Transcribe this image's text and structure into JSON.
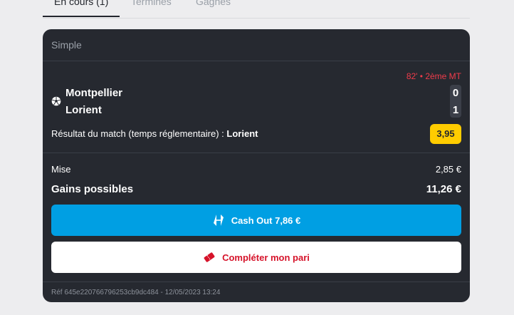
{
  "tabs": [
    {
      "label": "En cours (1)",
      "active": true
    },
    {
      "label": "Terminés",
      "active": false
    },
    {
      "label": "Gagnés",
      "active": false
    }
  ],
  "bet": {
    "type": "Simple",
    "live_status": "82' • 2ème MT",
    "sport_icon": "soccer-ball-icon",
    "home_team": "Montpellier",
    "away_team": "Lorient",
    "home_score": "0",
    "away_score": "1",
    "market_label": "Résultat du match (temps réglementaire) :",
    "selection": "Lorient",
    "odds": "3,95",
    "stake_label": "Mise",
    "stake_value": "2,85 €",
    "gains_label": "Gains possibles",
    "gains_value": "11,26 €",
    "cashout_label": "Cash Out 7,86 €",
    "complete_label": "Compléter mon pari",
    "reference": "Réf 645e220766796253cb9dc484 - 12/05/2023 13:24"
  },
  "colors": {
    "card_bg": "#262930",
    "live": "#f03c4b",
    "odds_bg": "#ffcc00",
    "cashout_bg": "#009fe3",
    "complete_text": "#d6132a"
  }
}
